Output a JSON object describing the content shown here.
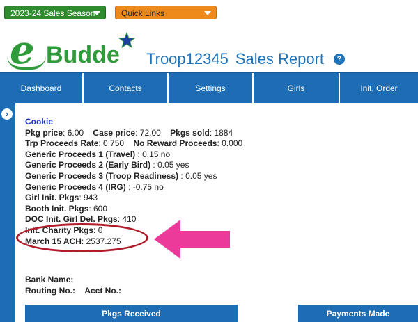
{
  "topbar": {
    "season_dropdown": "2023-24 Sales Season",
    "quick_links": "Quick Links"
  },
  "logo": {
    "e": "e",
    "budde": "Budde"
  },
  "header": {
    "troop": "Troop12345",
    "report": "Sales Report",
    "help": "?"
  },
  "nav": {
    "items": [
      "Dashboard",
      "Contacts",
      "Settings",
      "Girls",
      "Init. Order"
    ]
  },
  "report": {
    "heading": "Cookie",
    "pkg_price_label": "Pkg price",
    "pkg_price": ": 6.00",
    "case_price_label": "Case price",
    "case_price": ": 72.00",
    "pkgs_sold_label": "Pkgs sold",
    "pkgs_sold": ": 1884",
    "trp_rate_label": "Trp Proceeds Rate",
    "trp_rate": ": 0.750",
    "no_reward_label": "No Reward Proceeds",
    "no_reward": ": 0.000",
    "gen1_label": "Generic Proceeds 1",
    "gen1_name": " (Travel)",
    "gen1_val": " : 0.15 no",
    "gen2_label": "Generic Proceeds 2",
    "gen2_name": " (Early Bird)",
    "gen2_val": " : 0.05 yes",
    "gen3_label": "Generic Proceeds 3",
    "gen3_name": " (Troop Readiness)",
    "gen3_val": " : 0.05 yes",
    "gen4_label": "Generic Proceeds 4",
    "gen4_name": " (IRG)",
    "gen4_val": " : -0.75 no",
    "girl_init_label": "Girl Init. Pkgs",
    "girl_init": ": 943",
    "booth_init_label": "Booth Init. Pkgs",
    "booth_init": ": 600",
    "doc_init_label": "DOC Init. Girl Del. Pkgs",
    "doc_init": ": 410",
    "charity_label": "Init. Charity Pkgs",
    "charity": ": 0",
    "ach_label": "March 15 ACH",
    "ach": ": 2537.275"
  },
  "bank": {
    "bank_name": "Bank Name:",
    "routing": "Routing No.:",
    "acct": "Acct No.:"
  },
  "panels": {
    "pkgs_received": "Pkgs Received",
    "payments_made": "Payments Made"
  },
  "colors": {
    "nav_blue": "#1e6db4",
    "season_green": "#2e8b2e",
    "quicklinks_orange": "#ee8a1c",
    "logo_green": "#2f9b3a",
    "cookie_blue": "#1a33c8",
    "ellipse_red": "#b01c2a",
    "arrow_pink": "#ec3a9a"
  }
}
